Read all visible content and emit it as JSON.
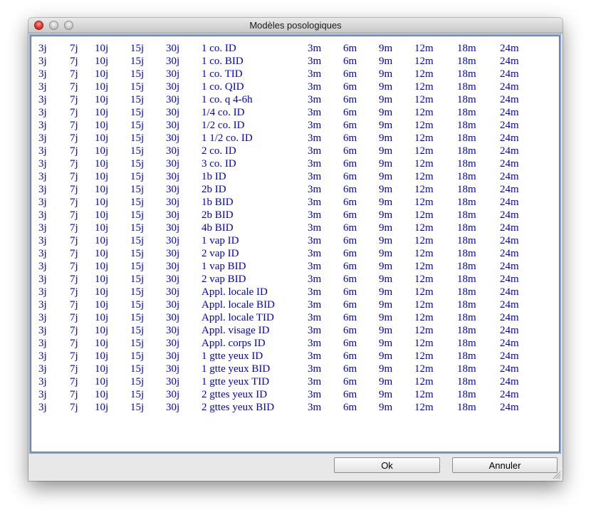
{
  "window": {
    "title": "Modèles posologiques"
  },
  "columns_pre": [
    "3j",
    "7j",
    "10j",
    "15j",
    "30j"
  ],
  "columns_post": [
    "3m",
    "6m",
    "9m",
    "12m",
    "18m",
    "24m"
  ],
  "rows": [
    "1 co. ID",
    "1 co. BID",
    "1 co. TID",
    "1 co. QID",
    "1 co. q 4-6h",
    "1/4 co. ID",
    "1/2 co. ID",
    "1 1/2 co. ID",
    "2 co. ID",
    "3 co. ID",
    "1b ID",
    "2b ID",
    "1b BID",
    "2b BID",
    "4b BID",
    "1 vap ID",
    "2 vap ID",
    "1 vap BID",
    "2 vap BID",
    "Appl. locale ID",
    "Appl. locale BID",
    "Appl. locale TID",
    "Appl. visage ID",
    "Appl. corps ID",
    "1 gtte yeux ID",
    "1 gtte yeux BID",
    "1 gtte yeux TID",
    "2 gttes yeux ID",
    "2 gttes yeux BID"
  ],
  "buttons": {
    "ok": "Ok",
    "cancel": "Annuler"
  },
  "colors": {
    "list_text": "#0000cc",
    "focus_ring": "#7ea6d8"
  }
}
